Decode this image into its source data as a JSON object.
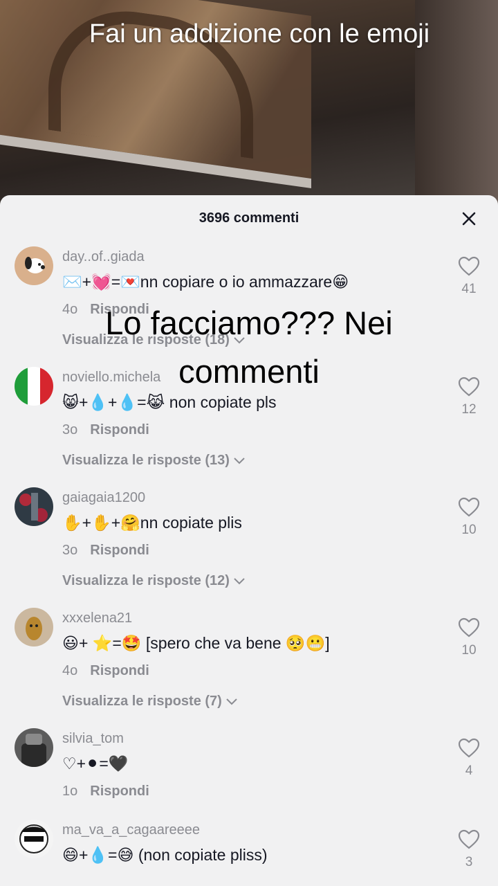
{
  "video": {
    "title": "Fai un addizione con le emoji"
  },
  "sheet": {
    "count": "3696 commenti"
  },
  "overlay": {
    "line1": "Lo facciamo??? Nei",
    "line2": "commenti"
  },
  "comments": [
    {
      "user": "day..of..giada",
      "text": "✉️+💓=💌nn copiare o io ammazzare😁",
      "age": "4o",
      "reply": "Rispondi",
      "replies": "Visualizza le risposte (18)",
      "likes": "41"
    },
    {
      "user": "noviello.michela",
      "text": "😸+💧+💧=😹 non copiate pls",
      "age": "3o",
      "reply": "Rispondi",
      "replies": "Visualizza le risposte (13)",
      "likes": "12"
    },
    {
      "user": "gaiagaia1200",
      "text": "✋+✋+🤗nn copiate plis",
      "age": "3o",
      "reply": "Rispondi",
      "replies": "Visualizza le risposte (12)",
      "likes": "10"
    },
    {
      "user": "xxxelena21",
      "text": "😃+ ⭐=🤩 [spero che va bene 🥺😬]",
      "age": "4o",
      "reply": "Rispondi",
      "replies": "Visualizza le risposte (7)",
      "likes": "10"
    },
    {
      "user": "silvia_tom",
      "text": "♡+⚫=🖤",
      "age": "1o",
      "reply": "Rispondi",
      "likes": "4"
    },
    {
      "user": "ma_va_a_cagaareeee",
      "text": "😄+💧=😅 (non copiate pliss)",
      "likes": "3"
    }
  ]
}
